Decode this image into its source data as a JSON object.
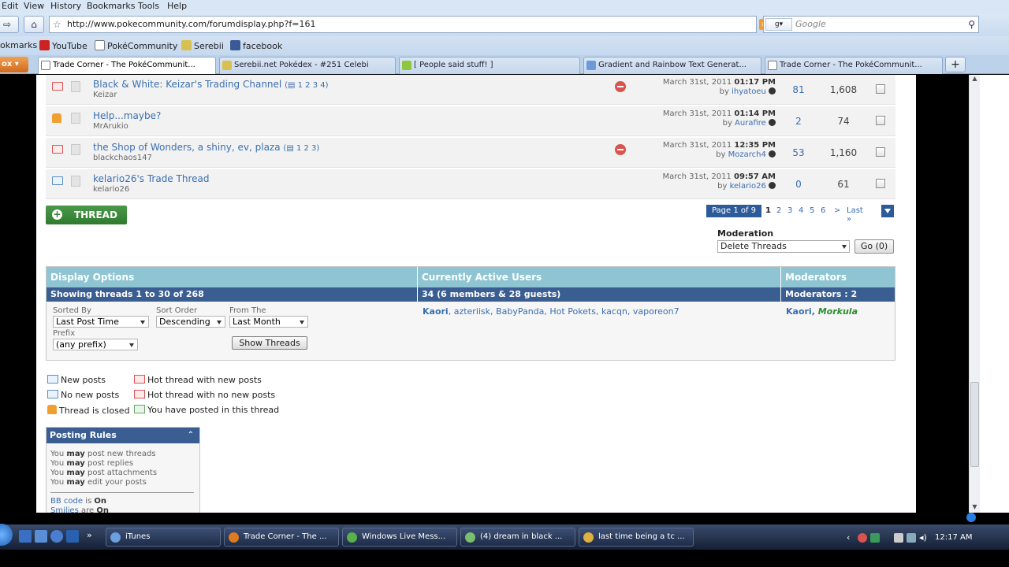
{
  "menu": [
    "Edit",
    "View",
    "History",
    "Bookmarks",
    "Tools",
    "Help"
  ],
  "nav": {
    "url": "http://www.pokecommunity.com/forumdisplay.php?f=161",
    "search_placeholder": "Google"
  },
  "bookmarks": [
    "okmarks",
    "YouTube",
    "PokéCommunity",
    "Serebii",
    "facebook"
  ],
  "tabs": [
    "Trade Corner - The PokéCommunit...",
    "Serebii.net Pokédex - #251 Celebi",
    "[ People said stuff! ]",
    "Gradient and Rainbow Text Generat...",
    "Trade Corner - The PokéCommunit..."
  ],
  "ff_button": "ox",
  "threads": [
    {
      "title": "Black & White: Keizar's Trading Channel",
      "pages": "1 2 3 4",
      "author": "Keizar",
      "date": "March 31st, 2011",
      "time": "01:17 PM",
      "by": "ihyatoeu",
      "replies": "81",
      "views": "1,608",
      "icon": "hot",
      "hot": true
    },
    {
      "title": "Help...maybe?",
      "pages": "",
      "author": "MrArukio",
      "date": "March 31st, 2011",
      "time": "01:14 PM",
      "by": "Aurafire",
      "replies": "2",
      "views": "74",
      "icon": "closed",
      "hot": false
    },
    {
      "title": "the Shop of Wonders, a shiny, ev, plaza",
      "pages": "1 2 3",
      "author": "blackchaos147",
      "date": "March 31st, 2011",
      "time": "12:35 PM",
      "by": "Mozarch4",
      "replies": "53",
      "views": "1,160",
      "icon": "hot",
      "hot": true
    },
    {
      "title": "kelario26's Trade Thread",
      "pages": "",
      "author": "kelario26",
      "date": "March 31st, 2011",
      "time": "09:57 AM",
      "by": "kelario26",
      "replies": "0",
      "views": "61",
      "icon": "new",
      "hot": false
    }
  ],
  "thread_button": "THREAD",
  "pagenav": {
    "label": "Page 1 of 9",
    "pages": [
      "1",
      "2",
      "3",
      "4",
      "5",
      "6",
      ">",
      "Last »"
    ]
  },
  "moderation": {
    "label": "Moderation",
    "selected": "Delete Threads",
    "go": "Go (0)"
  },
  "display": {
    "headers": [
      "Display Options",
      "Currently Active Users",
      "Moderators"
    ],
    "subs": [
      "Showing threads 1 to 30 of 268",
      "34 (6 members & 28 guests)",
      "Moderators : 2"
    ],
    "sorted_by_label": "Sorted By",
    "sorted_by": "Last Post Time",
    "sort_order_label": "Sort Order",
    "sort_order": "Descending",
    "from_label": "From The",
    "from": "Last Month",
    "prefix_label": "Prefix",
    "prefix": "(any prefix)",
    "show_button": "Show Threads",
    "active_users": [
      "Kaori",
      "azteriisk",
      "BabyPanda",
      "Hot Pokets",
      "kacqn",
      "vaporeon7"
    ],
    "moderators": [
      "Kaori",
      "Morkula"
    ]
  },
  "legend": [
    "New posts",
    "Hot thread with new posts",
    "No new posts",
    "Hot thread with no new posts",
    "Thread is closed",
    "You have posted in this thread"
  ],
  "rules": {
    "title": "Posting Rules",
    "lines": [
      {
        "pre": "You ",
        "b": "may",
        "post": " post new threads"
      },
      {
        "pre": "You ",
        "b": "may",
        "post": " post replies"
      },
      {
        "pre": "You ",
        "b": "may",
        "post": " post attachments"
      },
      {
        "pre": "You ",
        "b": "may",
        "post": " edit your posts"
      }
    ],
    "bbcode": "BB code",
    "bbcode_state": "On",
    "smilies": "Smilies",
    "smilies_state": "On"
  },
  "taskbar": {
    "items": [
      "iTunes",
      "Trade Corner - The ...",
      "Windows Live Mess...",
      "(4) dream in black ...",
      "last time being a tc ..."
    ],
    "time": "12:17 AM"
  }
}
